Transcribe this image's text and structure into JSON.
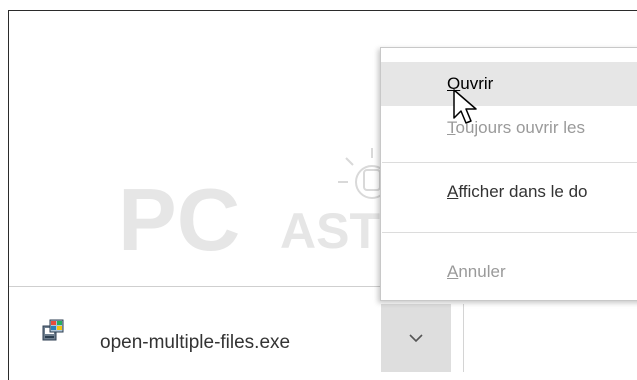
{
  "watermark": {
    "text_main": "PC",
    "text_sub": "ASTUCES"
  },
  "download_bar": {
    "file_name": "open-multiple-files.exe",
    "file_icon": "installer-icon",
    "dropdown_icon": "chevron-down-icon"
  },
  "context_menu": {
    "items": [
      {
        "mnemonic": "O",
        "rest": "uvrir",
        "state": "hovered"
      },
      {
        "mnemonic": "T",
        "rest": "oujours ouvrir les",
        "state": "disabled"
      },
      {
        "mnemonic": "A",
        "rest": "fficher dans le do",
        "state": "enabled"
      },
      {
        "mnemonic": "A",
        "rest": "nnuler",
        "state": "disabled"
      }
    ]
  },
  "colors": {
    "hover_bg": "#e6e6e6",
    "dropdown_bg": "#dedede",
    "disabled_text": "#9a9a9a",
    "text": "#333333"
  }
}
